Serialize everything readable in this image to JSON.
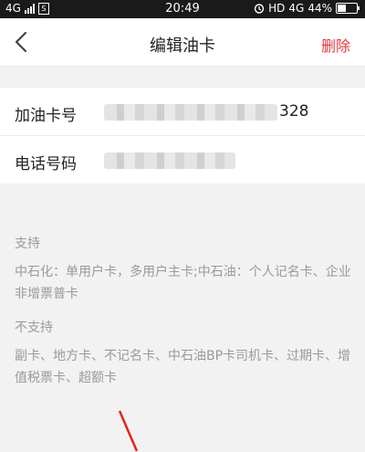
{
  "status_bar": {
    "network": "4G",
    "sim": "S",
    "time": "20:49",
    "hd": "HD",
    "network_right": "4G",
    "battery": "44%"
  },
  "navbar": {
    "title": "编辑油卡",
    "delete_label": "删除"
  },
  "form": {
    "card_label": "加油卡号",
    "card_value_visible": "328",
    "phone_label": "电话号码"
  },
  "info": {
    "support_title": "支持",
    "support_text": "中石化：单用户卡，多用户主卡;中石油：个人记名卡、企业非增票普卡",
    "nosupport_title": "不支持",
    "nosupport_text": "副卡、地方卡、不记名卡、中石油BP卡司机卡、过期卡、增值税票卡、超额卡"
  }
}
